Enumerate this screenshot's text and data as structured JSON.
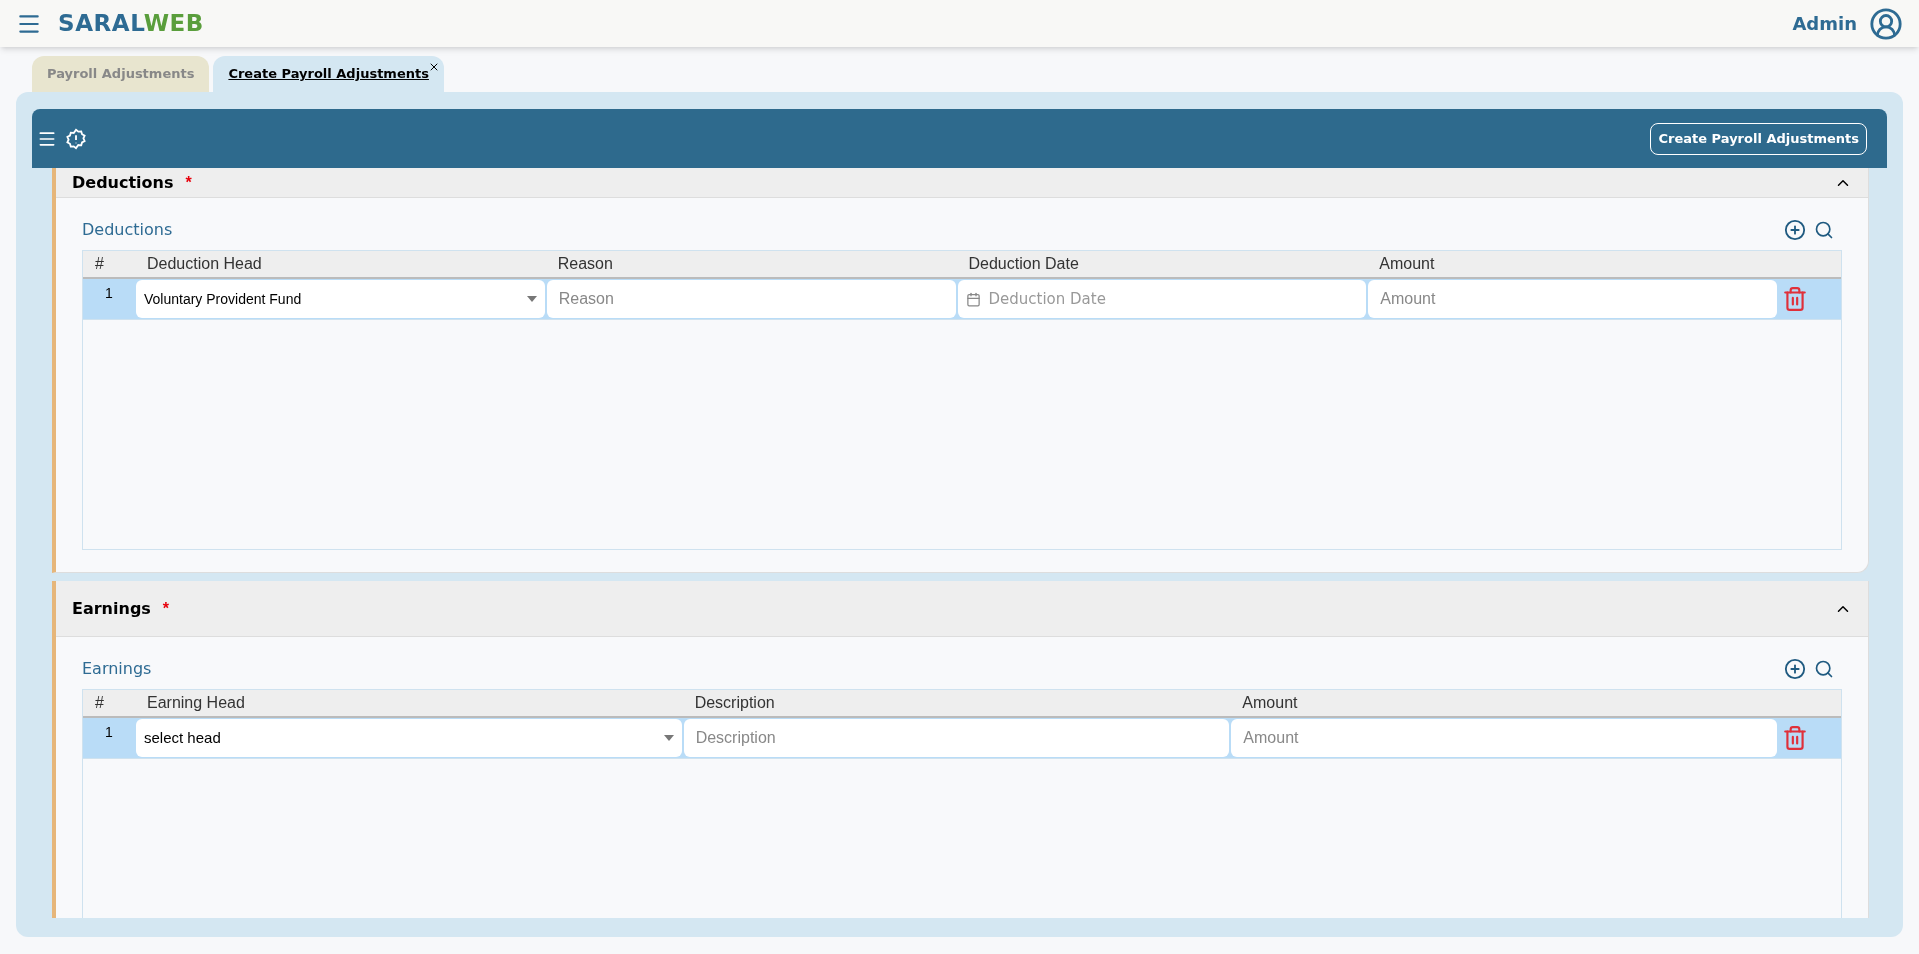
{
  "header": {
    "brand": "SARAL",
    "brand_accent": "WEB",
    "user": "Admin"
  },
  "tabs": [
    {
      "label": "Payroll Adjustments",
      "selected": false,
      "closable": false
    },
    {
      "label": "Create Payroll Adjustments",
      "selected": true,
      "closable": true
    }
  ],
  "toolbar": {
    "button": "Create Payroll Adjustments"
  },
  "sections": [
    {
      "title": "Deductions",
      "required_mark": "*",
      "expanded": true,
      "grid_title": "Deductions",
      "columns": [
        "#",
        "Deduction Head",
        "Reason",
        "Deduction Date",
        "Amount"
      ],
      "rows": [
        {
          "selected": true,
          "cells": [
            {
              "kind": "index",
              "value": "1"
            },
            {
              "kind": "select",
              "value": "Voluntary Provident Fund"
            },
            {
              "kind": "text",
              "placeholder": "Reason"
            },
            {
              "kind": "date",
              "placeholder": "Deduction Date"
            },
            {
              "kind": "text",
              "placeholder": "Amount"
            }
          ]
        }
      ]
    },
    {
      "title": "Earnings",
      "required_mark": "*",
      "expanded": true,
      "grid_title": "Earnings",
      "columns": [
        "#",
        "Earning Head",
        "Description",
        "Amount"
      ],
      "rows": [
        {
          "selected": true,
          "cells": [
            {
              "kind": "index",
              "value": "1"
            },
            {
              "kind": "select",
              "value": "select head"
            },
            {
              "kind": "text",
              "placeholder": "Description"
            },
            {
              "kind": "text",
              "placeholder": "Amount"
            }
          ]
        }
      ]
    }
  ]
}
